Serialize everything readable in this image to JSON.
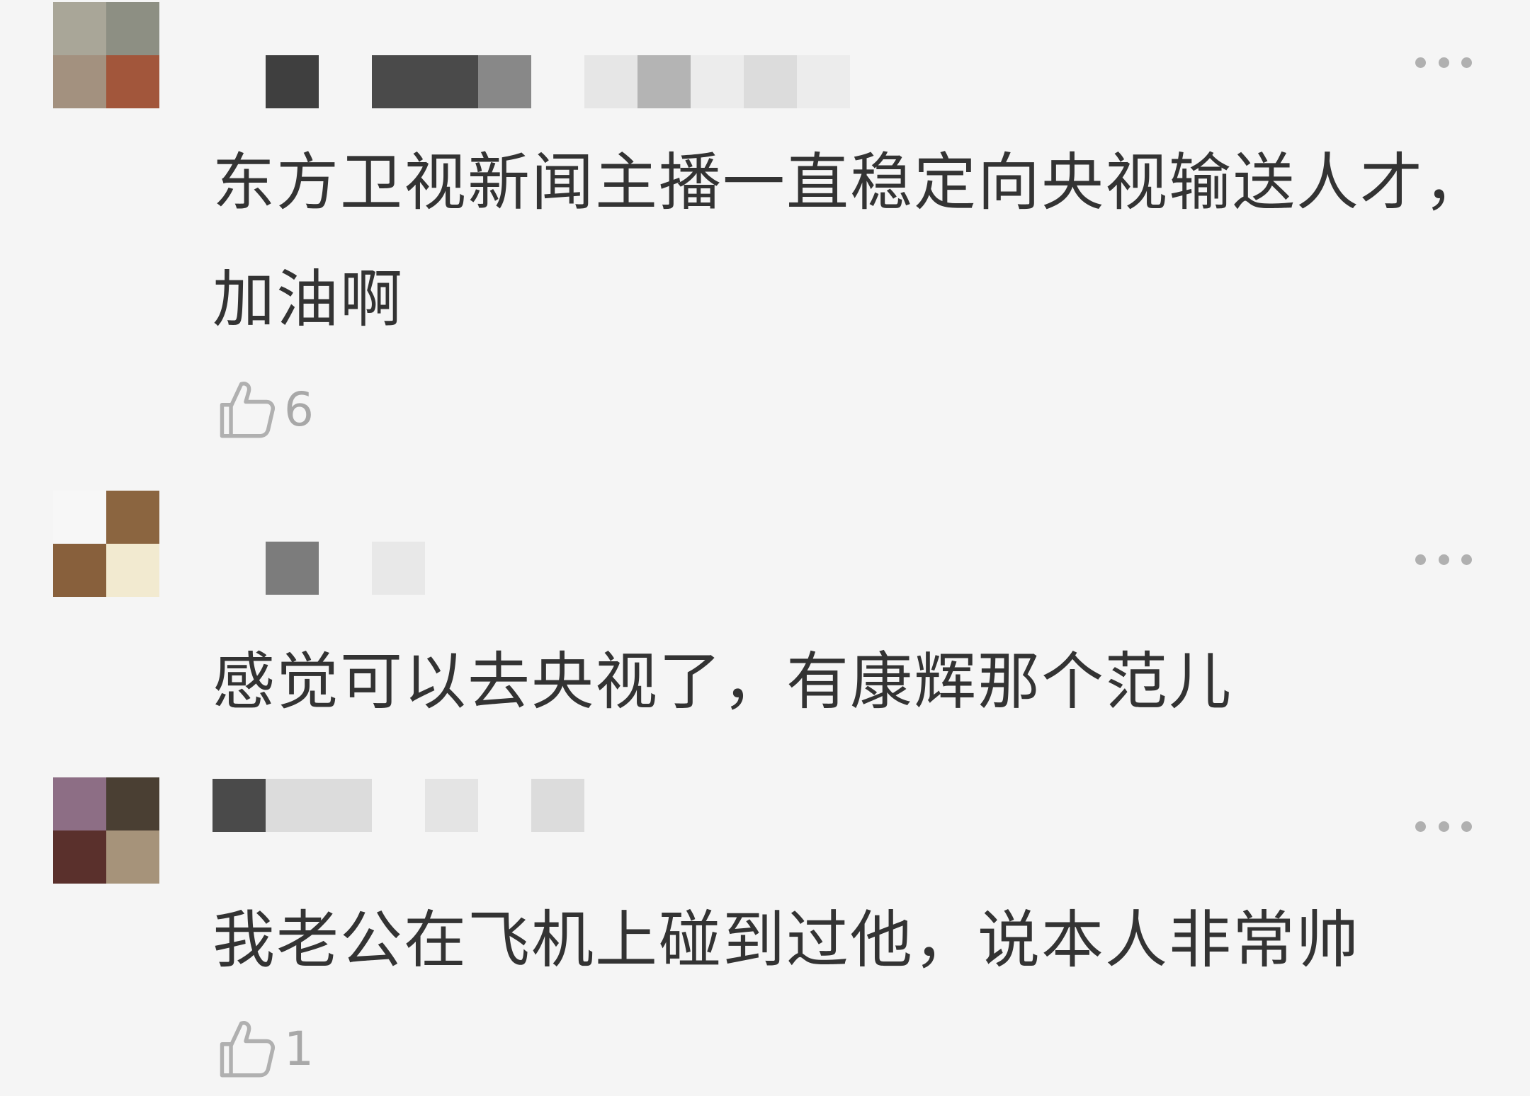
{
  "comments": [
    {
      "text": "东方卫视新闻主播一直稳定向央视输送人才，加油啊",
      "likes": "6",
      "avatar_colors": [
        "#a9a698",
        "#8d8f83",
        "#a3917f",
        "#a2563b"
      ],
      "name_colors": [
        "transparent",
        "#3f3f3f",
        "transparent",
        "#4a4a4a",
        "#4a4a4a",
        "#888888",
        "transparent",
        "#e6e6e6",
        "#b4b4b4",
        "#ececec",
        "#dcdcdc",
        "#ececec"
      ]
    },
    {
      "text": "感觉可以去央视了，有康辉那个范儿",
      "likes": "",
      "avatar_colors": [
        "#f7f7f7",
        "#8b6540",
        "#88603c",
        "#f2ead0"
      ],
      "name_colors": [
        "transparent",
        "#7c7c7c",
        "transparent",
        "#e8e8e8"
      ]
    },
    {
      "text": "我老公在飞机上碰到过他，说本人非常帅",
      "likes": "1",
      "avatar_colors": [
        "#8d6e85",
        "#4a3f33",
        "#5a302c",
        "#a6937a"
      ],
      "name_colors": [
        "#4a4a4a",
        "#dcdcdc",
        "#dcdcdc",
        "transparent",
        "#e4e4e4",
        "transparent",
        "#dcdcdc"
      ]
    }
  ],
  "icons": {
    "like": "thumbs-up-icon",
    "more": "more-options-icon"
  },
  "colors": {
    "background": "#f5f5f5",
    "text": "#333333",
    "meta": "#a8a8a8"
  }
}
